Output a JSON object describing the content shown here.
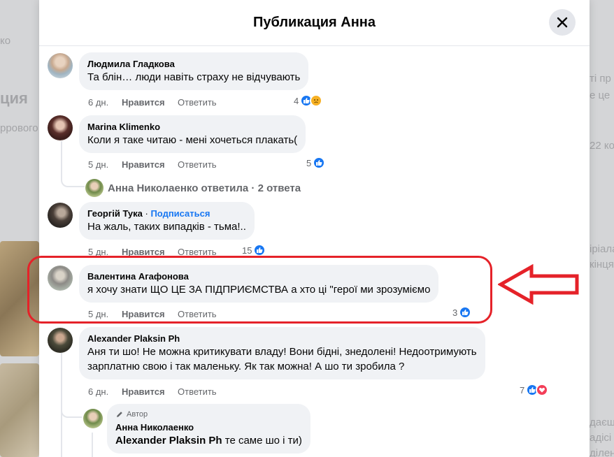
{
  "background": {
    "texts": [
      "ко",
      "ция",
      "ррового",
      "ті пр",
      "е це",
      "22 ко",
      "іріала",
      "кінця",
      "даєш,",
      "адісі",
      "ділен"
    ]
  },
  "modal": {
    "title": "Публикация Анна",
    "close_icon": "close-icon"
  },
  "comments": [
    {
      "author": "Людмила Гладкова",
      "text": "Та блін… люди навіть страху не відчувають",
      "time": "6 дн.",
      "like_label": "Нравится",
      "reply_label": "Ответить",
      "reactions_count": "4",
      "reactions": [
        "like",
        "sad"
      ]
    },
    {
      "author": "Marina Klimenko",
      "text": "Коли я таке читаю - мені хочеться плакать(",
      "time": "5 дн.",
      "like_label": "Нравится",
      "reply_label": "Ответить",
      "reactions_count": "5",
      "reactions": [
        "like"
      ],
      "replies_summary": "Анна Николаенко ответила · 2 ответа"
    },
    {
      "author": "Георгій Тука",
      "follow_label": "Подписаться",
      "text": "На жаль, таких випадків - тьма!..",
      "time": "5 дн.",
      "like_label": "Нравится",
      "reply_label": "Ответить",
      "reactions_count": "15",
      "reactions": [
        "like"
      ]
    },
    {
      "author": "Валентина Агафонова",
      "text": "я хочу знати ЩО ЦЕ ЗА ПІДПРИЄМСТВА а хто ці \"герої ми зрозуміємо",
      "time": "5 дн.",
      "like_label": "Нравится",
      "reply_label": "Ответить",
      "reactions_count": "3",
      "reactions": [
        "like"
      ]
    },
    {
      "author": "Alexander Plaksin Ph",
      "text_line1": "Аня ти шо! Не можна критикувати владу! Вони бідні, знедолені! Недоотримують",
      "text_line2": "зарплатню свою і так маленьку. Як так можна! А шо ти зробила ?",
      "time": "6 дн.",
      "like_label": "Нравится",
      "reply_label": "Ответить",
      "reactions_count": "7",
      "reactions": [
        "like",
        "love"
      ]
    }
  ],
  "reply": {
    "badge": "Автор",
    "author": "Анна Николаенко",
    "mention": "Alexander Plaksin Ph",
    "text": "те саме шо і ти)"
  },
  "colors": {
    "accent": "#1877f2",
    "highlight": "#e52229",
    "bubble": "#f0f2f5",
    "muted": "#65676b"
  }
}
